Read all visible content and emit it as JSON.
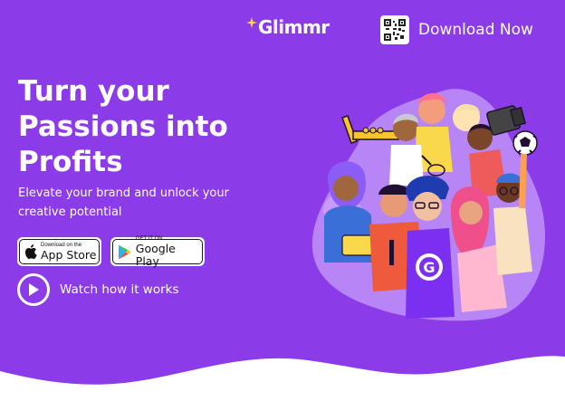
{
  "header": {
    "logo_text": "Glimmr",
    "logo_icon": "sparkle-icon",
    "download_label": "Download Now",
    "download_icon": "qr-code-icon"
  },
  "hero": {
    "title": "Turn your Passions into Profits",
    "subtitle": "Elevate your brand and unlock your creative potential"
  },
  "stores": {
    "apple": {
      "small": "Download on the",
      "big": "App Store",
      "icon": "apple-icon"
    },
    "google": {
      "small": "GET IT ON",
      "big": "Google Play",
      "icon": "google-play-icon"
    }
  },
  "watch": {
    "label": "Watch how it works",
    "icon": "play-icon"
  },
  "illustration": {
    "badge_letter": "G",
    "items": [
      "trumpet-icon",
      "soccer-ball-icon",
      "camera-icon",
      "whisk-icon"
    ]
  },
  "colors": {
    "background": "#8c3be8",
    "blob": "#b785f5",
    "accent_yellow": "#f9d84a",
    "wave": "#ffffff"
  }
}
